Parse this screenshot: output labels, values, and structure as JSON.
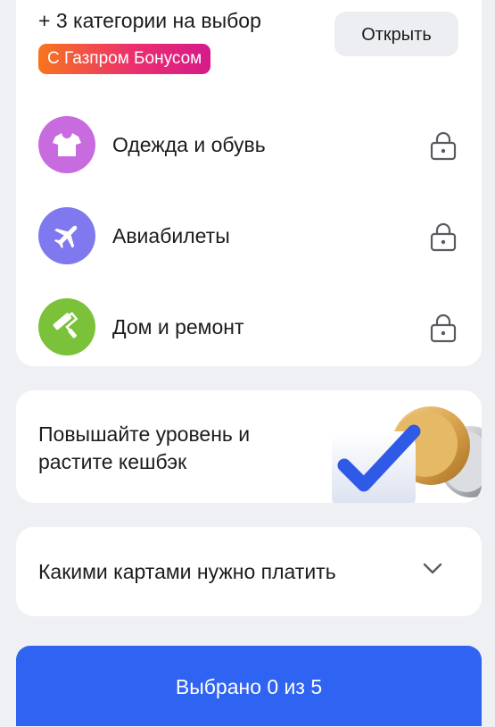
{
  "extra": {
    "title": "+ 3 категории на выбор",
    "badge": "С Газпром Бонусом",
    "open_label": "Открыть"
  },
  "categories": [
    {
      "label": "Одежда и обувь",
      "icon": "tshirt-icon",
      "color": "#c86bdf"
    },
    {
      "label": "Авиабилеты",
      "icon": "airplane-icon",
      "color": "#7f78ee"
    },
    {
      "label": "Дом и ремонт",
      "icon": "paint-roller-icon",
      "color": "#7bc23a"
    }
  ],
  "level": {
    "text": "Повышайте уровень и растите кешбэк"
  },
  "payment": {
    "label": "Какими картами нужно платить"
  },
  "footer": {
    "button_label": "Выбрано 0 из 5"
  },
  "colors": {
    "accent": "#2f63f1",
    "badge_start": "#f7751e",
    "badge_end": "#d61a8a"
  }
}
